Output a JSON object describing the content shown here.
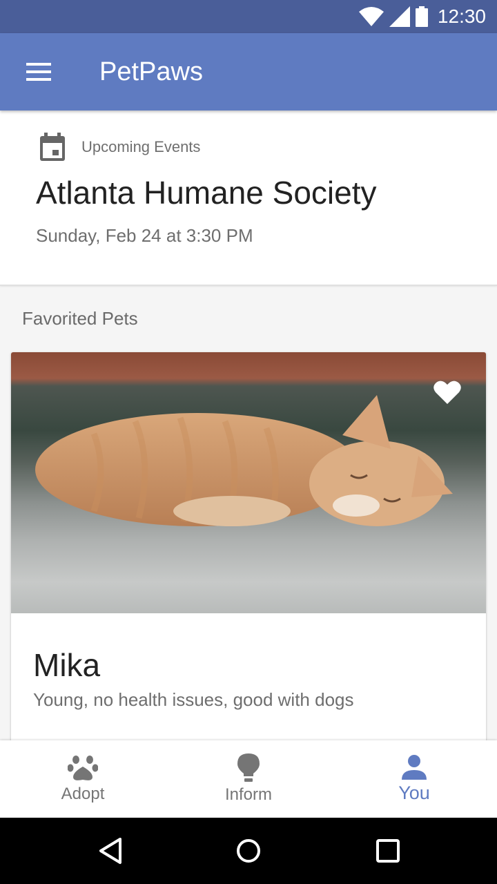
{
  "status_bar": {
    "time": "12:30",
    "icons": [
      "wifi-icon",
      "signal-icon",
      "battery-icon"
    ]
  },
  "app_bar": {
    "title": "PetPaws",
    "menu_icon": "menu-icon",
    "background": "#5f7bc1"
  },
  "event_card": {
    "label": "Upcoming Events",
    "icon": "calendar-icon",
    "title": "Atlanta Humane Society",
    "time": "Sunday, Feb 24 at 3:30 PM"
  },
  "favorites": {
    "section_title": "Favorited Pets",
    "pets": [
      {
        "name": "Mika",
        "description": "Young, no health issues, good with dogs",
        "favorited": true,
        "image": "sleeping orange kitten photo"
      }
    ]
  },
  "bottom_nav": {
    "items": [
      {
        "label": "Adopt",
        "icon": "paw-icon",
        "active": false
      },
      {
        "label": "Inform",
        "icon": "lightbulb-icon",
        "active": false
      },
      {
        "label": "You",
        "icon": "person-icon",
        "active": true
      }
    ],
    "active_color": "#5f7bc1"
  },
  "system_nav": {
    "buttons": [
      "back-icon",
      "home-icon",
      "recents-icon"
    ]
  }
}
